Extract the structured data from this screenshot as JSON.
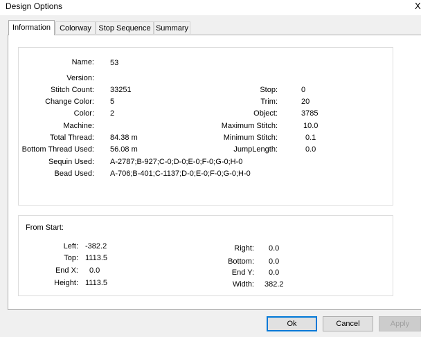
{
  "window": {
    "title": "Design Options",
    "close_glyph": "X"
  },
  "tabs": [
    "Information",
    "Colorway",
    "Stop Sequence",
    "Summary"
  ],
  "info": {
    "name_label": "Name:",
    "name_value": "53",
    "version_label": "Version:",
    "version_value": "",
    "stitch_count_label": "Stitch Count:",
    "stitch_count_value": "33251",
    "change_color_label": "Change Color:",
    "change_color_value": "5",
    "color_label": "Color:",
    "color_value": "2",
    "machine_label": "Machine:",
    "machine_value": "",
    "total_thread_label": "Total Thread:",
    "total_thread_value": "84.38 m",
    "bottom_thread_label": "Bottom Thread Used:",
    "bottom_thread_value": "56.08 m",
    "sequin_used_label": "Sequin Used:",
    "sequin_used_value": "A-2787;B-927;C-0;D-0;E-0;F-0;G-0;H-0",
    "bead_used_label": "Bead Used:",
    "bead_used_value": "A-706;B-401;C-1137;D-0;E-0;F-0;G-0;H-0",
    "stop_label": "Stop:",
    "stop_value": "0",
    "trim_label": "Trim:",
    "trim_value": "20",
    "object_label": "Object:",
    "object_value": "3785",
    "max_stitch_label": "Maximum Stitch:",
    "max_stitch_value": "10.0",
    "min_stitch_label": "Minimum Stitch:",
    "min_stitch_value": "0.1",
    "jump_length_label": "JumpLength:",
    "jump_length_value": "0.0"
  },
  "from_start": {
    "header": "From Start:",
    "left_label": "Left:",
    "left_value": "-382.2",
    "top_label": "Top:",
    "top_value": "1113.5",
    "endx_label": "End X:",
    "endx_value": "0.0",
    "height_label": "Height:",
    "height_value": "1113.5",
    "right_label": "Right:",
    "right_value": "0.0",
    "bottom_label": "Bottom:",
    "bottom_value": "0.0",
    "endy_label": "End Y:",
    "endy_value": "0.0",
    "width_label": "Width:",
    "width_value": "382.2"
  },
  "buttons": {
    "ok": "Ok",
    "cancel": "Cancel",
    "apply": "Apply"
  }
}
